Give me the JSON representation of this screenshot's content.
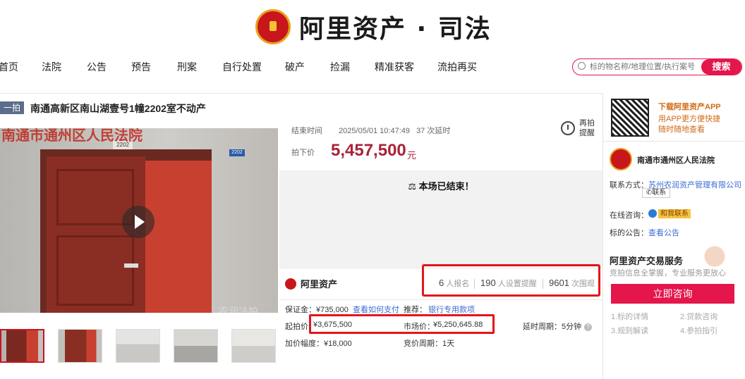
{
  "brand": {
    "title": "阿里资产 · 司法"
  },
  "nav": [
    "首页",
    "法院",
    "公告",
    "预告",
    "刑案",
    "自行处置",
    "破产",
    "捡漏",
    "精准获客",
    "流拍再买"
  ],
  "search": {
    "placeholder": "标的物名称/地理位置/执行案号",
    "button": "搜索"
  },
  "item": {
    "tag": "一拍",
    "title": "南通高新区南山湖壹号1幢2202室不动产",
    "end_label": "结束时间",
    "end_time": "2025/05/01 10:47:49",
    "delay_count": "37 次延时",
    "price_label": "拍下价",
    "price": "5,457,500",
    "currency": "元",
    "remind": "再拍提醒",
    "ended_msg": "本场已结束！",
    "photo_text": "南通市通州区人民法院",
    "door_number": "2202",
    "watermark": "农润法拍"
  },
  "platform": "阿里资产",
  "stats": {
    "signups": "6",
    "signups_label": "人报名",
    "reminders": "190",
    "reminders_label": "人设置提醒",
    "views": "9601",
    "views_label": "次围观"
  },
  "rows": {
    "deposit": "保证金：¥735,000",
    "howto": "查看如何支付",
    "recommend": "推荐：",
    "bank": "银行专用款项",
    "start_label": "起拍价",
    "start_price": "¥3,675,500",
    "market_label": "市场价：",
    "market_price": "¥5,250,645.88",
    "delay_period": "延时周期：5分钟",
    "increment": "加价幅度：¥18,000",
    "bid_period": "竞价周期：1天"
  },
  "sidebar": {
    "download_title": "下载阿里资产APP",
    "download_sub1": "用APP更方便快捷",
    "download_sub2": "随时随地查看",
    "court": "南通市通州区人民法院",
    "contact_label": "联系方式：",
    "contact_value": "苏州农润资产管理有限公司",
    "contact_btn": "联系",
    "online_label": "在线咨询：",
    "online_btn": "和我联系",
    "notice_label": "标的公告：",
    "notice_link": "查看公告",
    "service_title": "阿里资产交易服务",
    "service_sub": "竞拍信息全掌握，专业服务更放心",
    "consult": "立即咨询",
    "tips": [
      "1.标的详情",
      "2.贷款咨询",
      "3.规则解读",
      "4.参拍指引"
    ]
  },
  "colors": {
    "accent": "#e4164c",
    "price": "#a8233a",
    "highlight_box": "#e4151b",
    "link": "#3b6bd1"
  }
}
